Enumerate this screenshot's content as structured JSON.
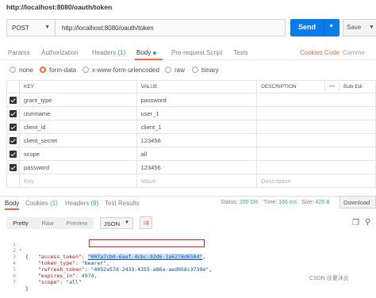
{
  "title": "http://localhost:8080/oauth/token",
  "request": {
    "method": "POST",
    "url": "http://localhost:8080/oauth/token",
    "send_label": "Send",
    "save_label": "Save"
  },
  "request_tabs": {
    "params": "Params",
    "authorization": "Authorization",
    "headers": "Headers",
    "headers_count": "(1)",
    "body": "Body",
    "pre_request": "Pre-request Script",
    "tests": "Tests",
    "cookies": "Cookies",
    "code": "Code",
    "comments": "Comme"
  },
  "body_types": [
    "none",
    "form-data",
    "x-www-form-urlencoded",
    "raw",
    "binary"
  ],
  "selected_body_type": "form-data",
  "table": {
    "headers": {
      "key": "KEY",
      "value": "VALUE",
      "description": "DESCRIPTION",
      "more": "•••",
      "bulk_edit": "Bulk Edi"
    },
    "rows": [
      {
        "key": "grant_type",
        "value": "password"
      },
      {
        "key": "username",
        "value": "user_1"
      },
      {
        "key": "client_id",
        "value": "client_1"
      },
      {
        "key": "client_secret",
        "value": "123456"
      },
      {
        "key": "scope",
        "value": "all"
      },
      {
        "key": "password",
        "value": "123456"
      }
    ],
    "placeholder": {
      "key": "Key",
      "value": "Value",
      "description": "Description"
    }
  },
  "response": {
    "tabs": {
      "body": "Body",
      "cookies": "Cookies",
      "cookies_count": "(1)",
      "headers": "Headers",
      "headers_count": "(9)",
      "test_results": "Test Results"
    },
    "status_label": "Status:",
    "status_value": "200 OK",
    "time_label": "Time:",
    "time_value": "166 ms",
    "size_label": "Size:",
    "size_value": "426 B",
    "download": "Download",
    "formats": [
      "Pretty",
      "Raw",
      "Preview"
    ],
    "format_type": "JSON"
  },
  "json_lines": [
    {
      "n": "1",
      "text": "{"
    },
    {
      "n": "2",
      "key": "\"access_token\": ",
      "val": "\"007a7cb0-6aef-4cbc-92d6-3a6278d6504\"",
      "tail": ","
    },
    {
      "n": "3",
      "key": "\"token_type\": ",
      "val": "\"bearer\"",
      "tail": ","
    },
    {
      "n": "4",
      "key": "\"refresh_token\": ",
      "val": "\"4052a57d-2433-4355-a86a-aed058c3739e\"",
      "tail": ","
    },
    {
      "n": "5",
      "key": "\"expires_in\": ",
      "num": "4974",
      "tail": ","
    },
    {
      "n": "6",
      "key": "\"scope\": ",
      "val": "\"all\""
    },
    {
      "n": "7",
      "text": "}"
    }
  ],
  "watermark": "CSDN @夏沐炎"
}
